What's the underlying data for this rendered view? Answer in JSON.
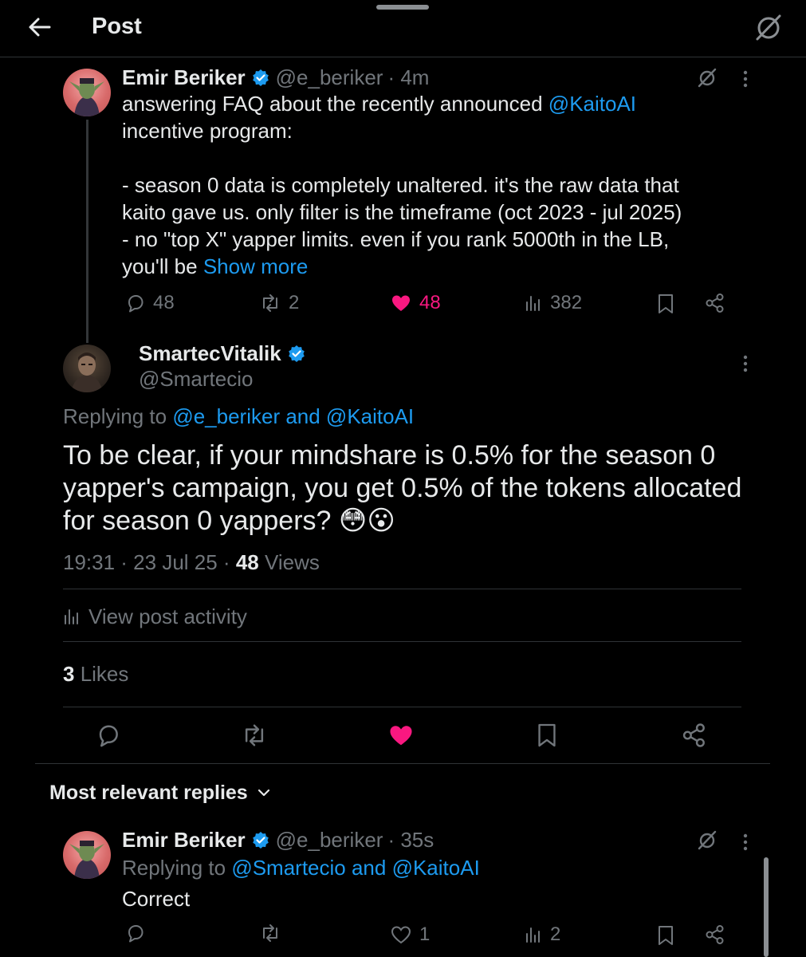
{
  "header": {
    "title": "Post"
  },
  "parent_post": {
    "author_name": "Emir Beriker",
    "handle": "@e_beriker",
    "time": "· 4m",
    "text_line1": "answering FAQ about the recently announced ",
    "mention": "@KaitoAI",
    "text_line2": "incentive program:",
    "text_line3": "- season 0 data is completely unaltered. it's the raw data that",
    "text_line4": "kaito gave us. only filter is the timeframe (oct 2023 - jul 2025)",
    "text_line5": "- no \"top X\" yapper limits. even if you rank 5000th in the LB,",
    "text_line6": "you'll be ",
    "show_more": "Show more",
    "replies": "48",
    "reposts": "2",
    "likes": "48",
    "views": "382"
  },
  "main_post": {
    "author_name": "SmartecVitalik",
    "handle": "@Smartecio",
    "replying_prefix": "Replying to ",
    "replying_to": "@e_beriker and @KaitoAI",
    "text_line1": "To be clear, if your mindshare is 0.5% for the season 0",
    "text_line2": "yapper's campaign,  you get 0.5% of the tokens allocated",
    "text_line3": "for season 0 yappers? 😳😮",
    "timestamp": "19:31 · 23 Jul 25 · ",
    "views_count": "48",
    "views_label": " Views",
    "activity_label": "View post activity",
    "likes_count": "3",
    "likes_label": " Likes"
  },
  "replies_section": {
    "sort_label": "Most relevant replies"
  },
  "reply": {
    "author_name": "Emir Beriker",
    "handle": "@e_beriker",
    "time": "· 35s",
    "replying_prefix": "Replying to ",
    "replying_to": "@Smartecio and @KaitoAI",
    "text": "Correct",
    "likes": "1",
    "views": "2"
  },
  "colors": {
    "background": "#000000",
    "text": "#e7e9ea",
    "secondary": "#71767b",
    "accent": "#1d9bf0",
    "like": "#f91880",
    "divider": "#2f3336"
  },
  "icons": [
    "back-arrow-icon",
    "grok-icon",
    "verified-badge-icon",
    "more-icon",
    "reply-icon",
    "repost-icon",
    "like-icon",
    "views-icon",
    "bookmark-icon",
    "share-icon",
    "chevron-down-icon"
  ]
}
